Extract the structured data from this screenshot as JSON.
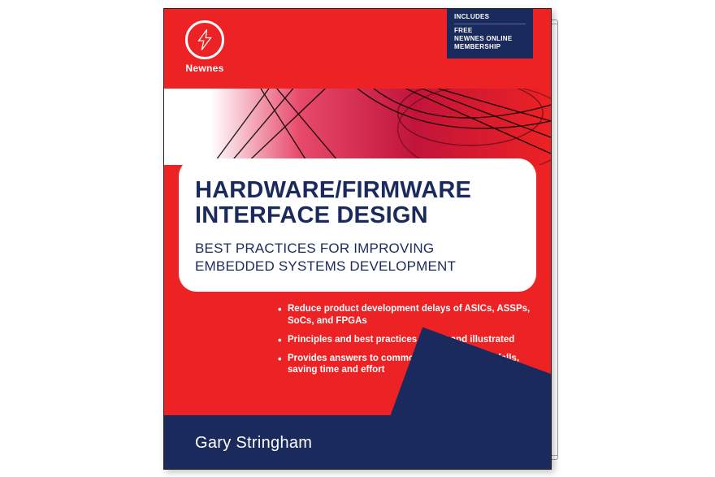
{
  "publisher": {
    "name": "Newnes"
  },
  "includes_box": {
    "heading": "INCLUDES",
    "line1": "FREE",
    "line2": "NEWNES ONLINE",
    "line3": "MEMBERSHIP"
  },
  "title": {
    "line1": "HARDWARE/FIRMWARE",
    "line2": "INTERFACE DESIGN"
  },
  "subtitle": {
    "line1": "BEST PRACTICES FOR IMPROVING",
    "line2": "EMBEDDED SYSTEMS DEVELOPMENT"
  },
  "bullets": [
    "Reduce product development delays of ASICs, ASSPs, SoCs, and FPGAs",
    "Principles and best practices taught and illustrated",
    "Provides answers to common problems and pitfalls, saving time and effort"
  ],
  "author": "Gary Stringham",
  "colors": {
    "accent_red": "#ed2224",
    "accent_navy": "#1b2a5c"
  }
}
